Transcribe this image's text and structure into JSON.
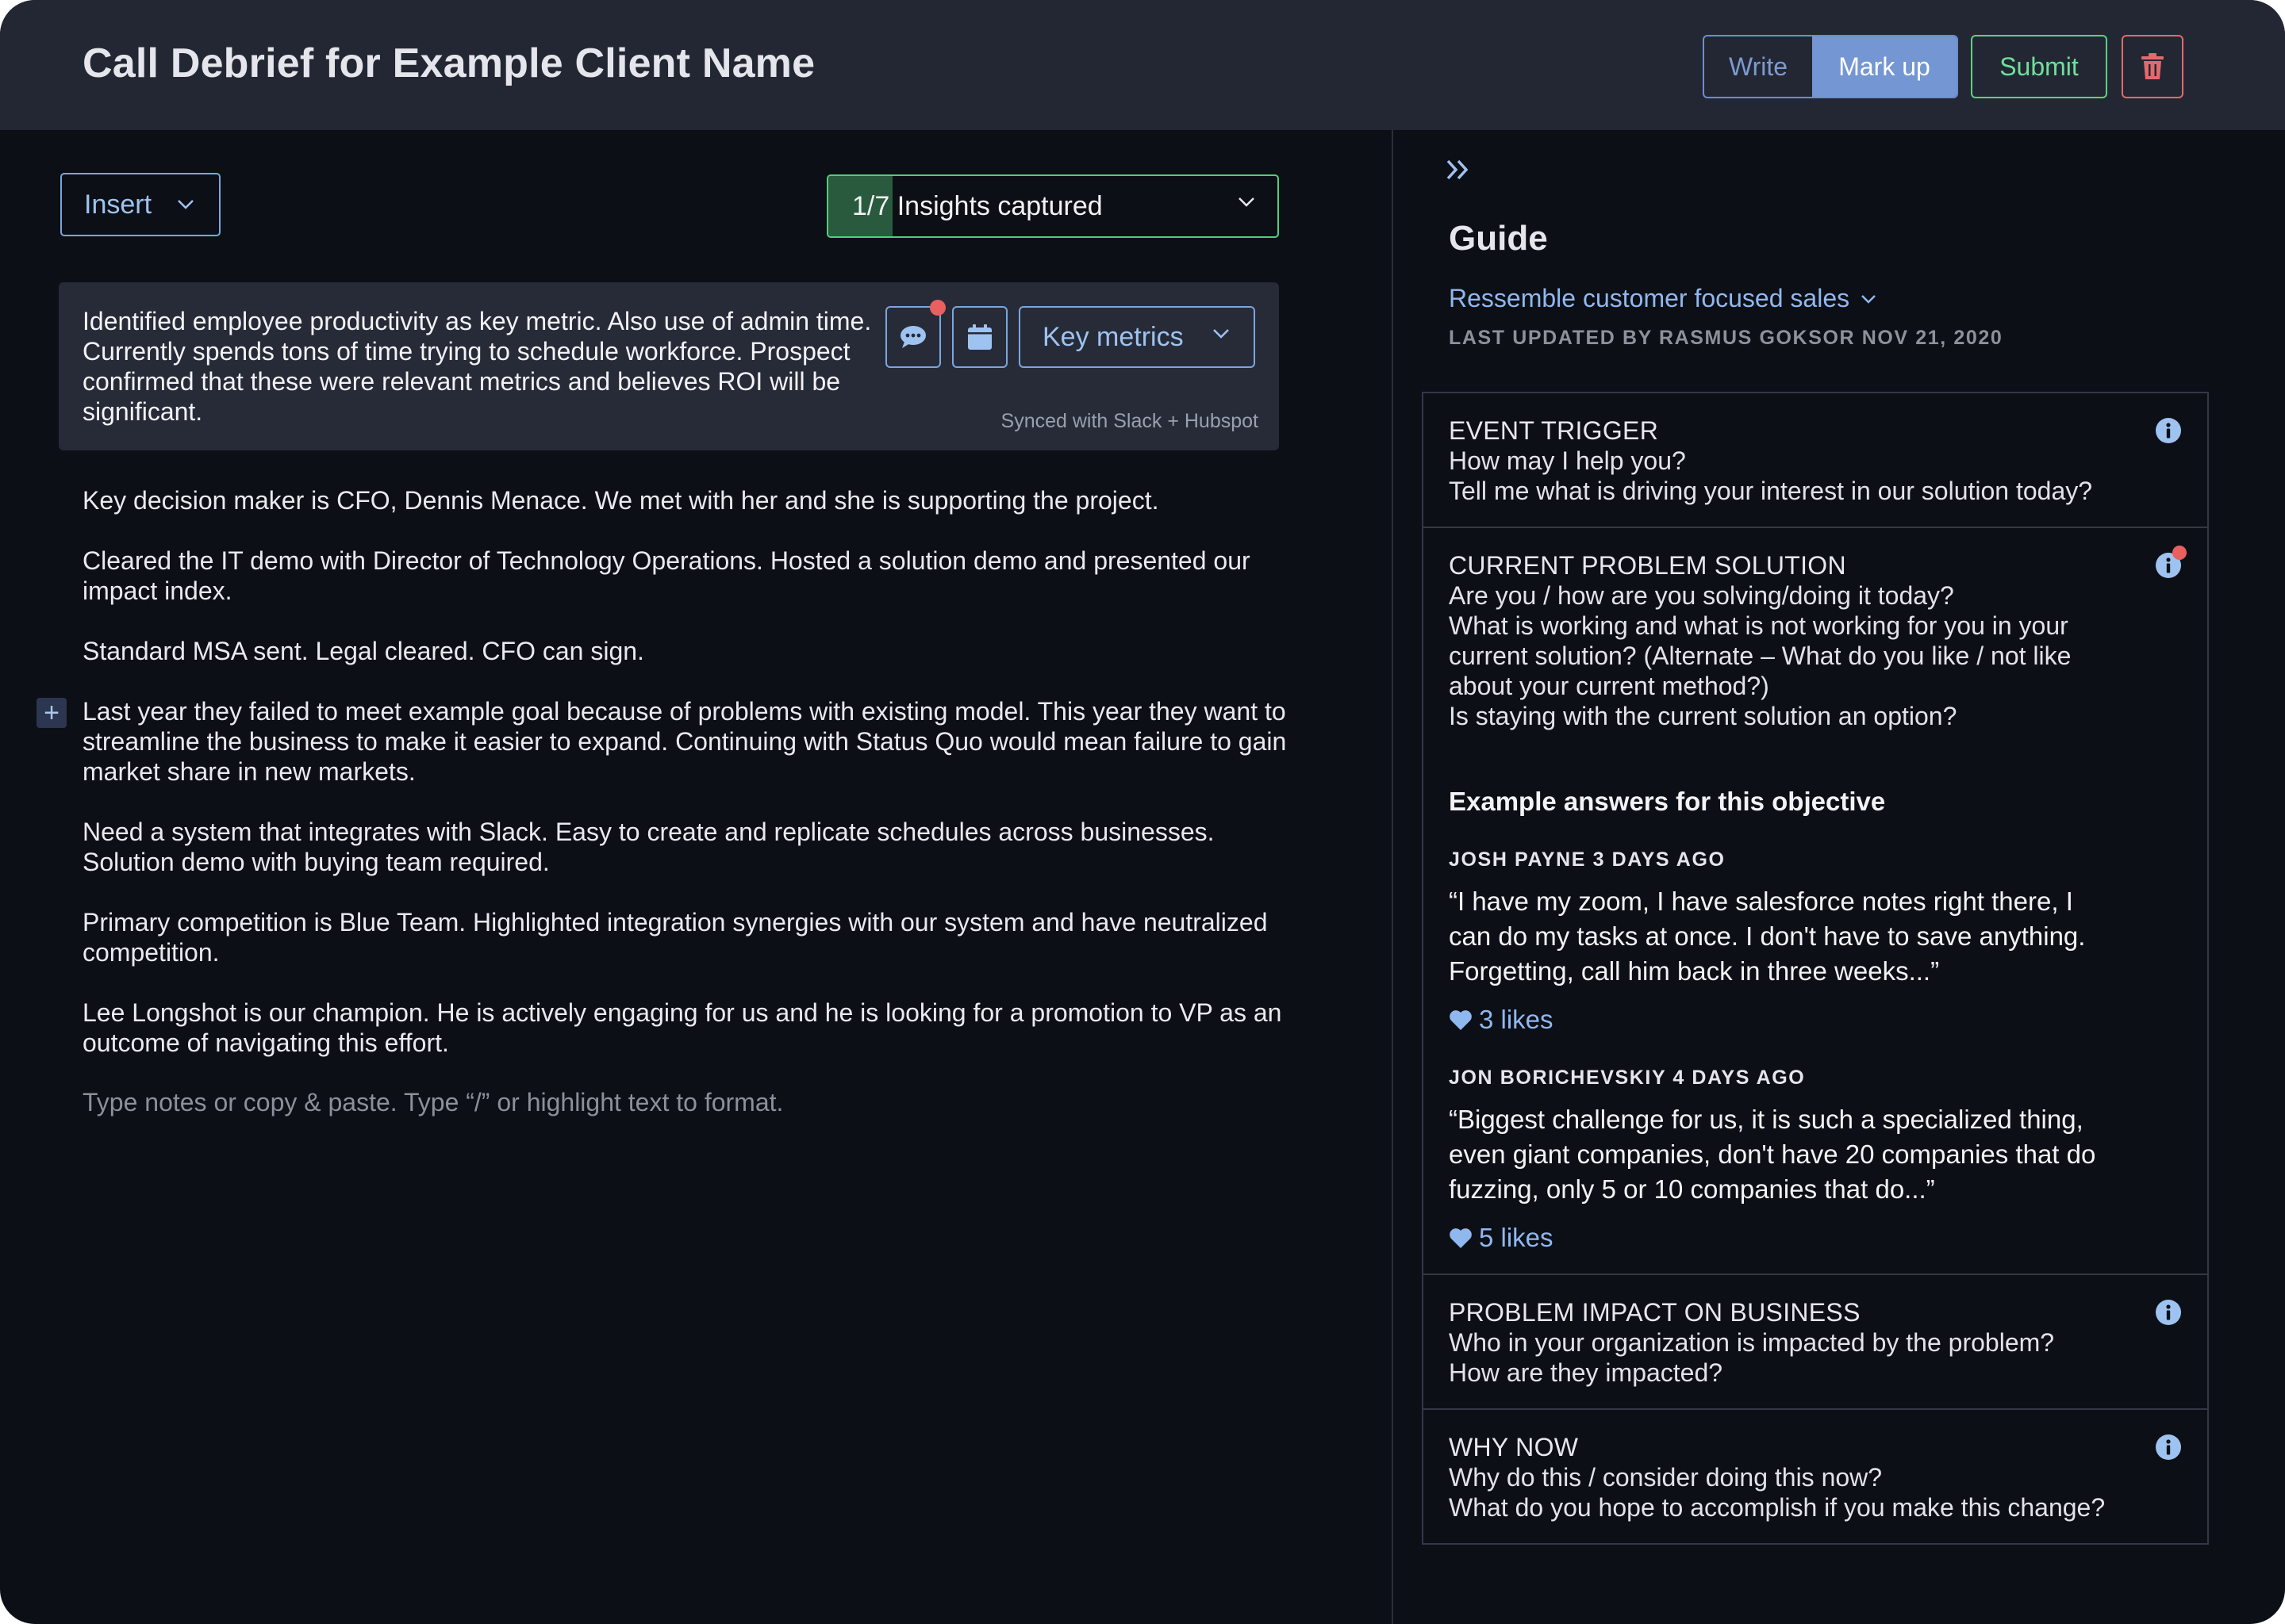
{
  "header": {
    "title": "Call Debrief for Example Client Name",
    "mode_toggle": {
      "write_label": "Write",
      "markup_label": "Mark up",
      "active": "Mark up"
    },
    "submit_label": "Submit",
    "delete_icon": "trash-icon"
  },
  "editor": {
    "insert_label": "Insert",
    "insights": {
      "label": "1/7 Insights captured",
      "captured": 1,
      "total": 7
    },
    "insight_card": {
      "text": "Identified employee productivity as key metric. Also use of admin time. Currently spends tons of time trying to schedule workforce. Prospect confirmed that these were relevant metrics and believes ROI will be significant.",
      "comment_icon": "chat-bubble-icon",
      "calendar_icon": "calendar-icon",
      "category_select": "Key metrics",
      "sync_status": "Synced with Slack + Hubspot"
    },
    "notes": [
      "Key decision maker is CFO, Dennis Menace. We met with her and she is supporting the project.",
      "Cleared the IT demo with Director of Technology Operations. Hosted a solution demo and presented our impact index.",
      "Standard MSA sent. Legal cleared. CFO can sign.",
      "Last year they failed to meet example goal because of problems with existing model. This year they want to streamline the business to make it easier to expand. Continuing with Status Quo would mean failure to gain market share in new markets.",
      "Need a system that integrates with Slack. Easy to create and replicate schedules across businesses. Solution demo with buying team required.",
      "Primary competition is Blue Team. Highlighted integration synergies with our system and have neutralized competition.",
      "Lee Longshot is our champion. He is actively engaging for us and he is looking for a promotion to VP as an outcome of navigating this effort."
    ],
    "placeholder": "Type notes or copy & paste. Type “/” or highlight text to format.",
    "add_block_symbol": "+"
  },
  "guide": {
    "collapse_icon": "double-chevron-right-icon",
    "title": "Guide",
    "playbook_select": "Ressemble customer focused sales",
    "last_updated": "LAST UPDATED BY RASMUS GOKSOR NOV 21, 2020",
    "sections": [
      {
        "heading": "EVENT TRIGGER",
        "lines": [
          "How may I help you?",
          "Tell me what is driving your interest in our solution today?"
        ]
      },
      {
        "heading": "CURRENT PROBLEM SOLUTION",
        "lines": [
          "Are you / how are you solving/doing it today?",
          "What is working and what is not working for you in your current solution? (Alternate – What do you like / not like about your current method?)",
          "Is staying with the current solution an option?"
        ],
        "has_notification": true,
        "examples_title": "Example answers for this objective",
        "examples": [
          {
            "author": "JOSH PAYNE",
            "age": "3 DAYS AGO",
            "quote": "“I have my zoom, I have salesforce notes right there, I can do my tasks at once. I don't have to save anything. Forgetting, call him back in three weeks...”",
            "likes": "3 likes"
          },
          {
            "author": "JON BORICHEVSKIY",
            "age": "4 DAYS AGO",
            "quote": "“Biggest challenge for us, it is such a specialized thing, even giant companies, don't have 20 companies that do fuzzing, only 5 or 10 companies that do...”",
            "likes": "5 likes"
          }
        ]
      },
      {
        "heading": "PROBLEM IMPACT ON BUSINESS",
        "lines": [
          "Who in your organization is impacted by the problem?",
          "How are they impacted?"
        ]
      },
      {
        "heading": "WHY NOW",
        "lines": [
          "Why do this / consider doing this now?",
          "What do you hope to accomplish if you make this change?"
        ]
      }
    ]
  },
  "colors": {
    "accent_blue": "#7497d3",
    "success_green": "#5fcf85",
    "danger_red": "#e06b6b",
    "notification_red": "#ea5f5f",
    "background": "#0d0f16",
    "header_bg": "#232733"
  }
}
